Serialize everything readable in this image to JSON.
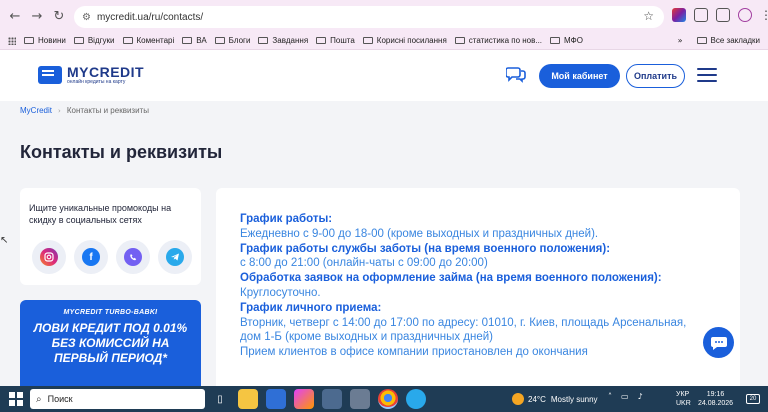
{
  "browser": {
    "url": "mycredit.ua/ru/contacts/",
    "bookmarks": [
      "Новини",
      "Відгуки",
      "Коментарі",
      "ВА",
      "Блоги",
      "Завдання",
      "Пошта",
      "Корисні посилання",
      "статистика по нов...",
      "МФО"
    ],
    "all_bookmarks": "Все закладки"
  },
  "header": {
    "logo_name": "MYCREDIT",
    "logo_tagline": "онлайн кредиты на карту",
    "cabinet_button": "Мой кабинет",
    "pay_button": "Оплатить"
  },
  "breadcrumb": {
    "home": "MyCredit",
    "current": "Контакты и реквизиты"
  },
  "page_title": "Контакты и реквизиты",
  "promo": {
    "text": "Ищите уникальные промокоды на скидку в социальных сетях",
    "socials": [
      "instagram",
      "facebook",
      "viber",
      "telegram"
    ]
  },
  "banner": {
    "subtitle": "MYCREDIT TURBO-BABKI",
    "main": "ЛОВИ КРЕДИТ ПОД 0.01% БЕЗ КОМИССИЙ НА ПЕРВЫЙ ПЕРИОД*"
  },
  "content": [
    {
      "type": "h",
      "text": "График работы:"
    },
    {
      "type": "t",
      "text": "Ежедневно с 9-00 до 18-00 (кроме выходных и праздничных дней)."
    },
    {
      "type": "h",
      "text": "График работы службы заботы (на время военного положения):"
    },
    {
      "type": "t",
      "text": "с 8:00 до 21:00 (онлайн-чаты с 09:00 до 20:00)"
    },
    {
      "type": "h",
      "text": "Обработка заявок на оформление займа (на время военного положения):"
    },
    {
      "type": "t",
      "text": "Круглосуточно."
    },
    {
      "type": "h",
      "text": "График личного приема:"
    },
    {
      "type": "t",
      "text": "Вторник, четверг с 14:00 до 17:00 по адресу: 01010, г. Киев, площадь Арсенальная, дом 1-Б (кроме выходных и праздничных дней)"
    },
    {
      "type": "t",
      "text": "Прием клиентов в офисе компании приостановлен до окончания"
    }
  ],
  "taskbar": {
    "search_placeholder": "Поиск",
    "temperature": "24°C",
    "weather": "Mostly sunny",
    "lang_top": "УКР",
    "lang_bottom": "UKR",
    "time": "19:16",
    "date": "24.08.2026",
    "notifications": "20"
  },
  "colors": {
    "brand": "#1a5fdb",
    "brand_dark": "#1f3a8a",
    "text_blue": "#3a86e0"
  }
}
